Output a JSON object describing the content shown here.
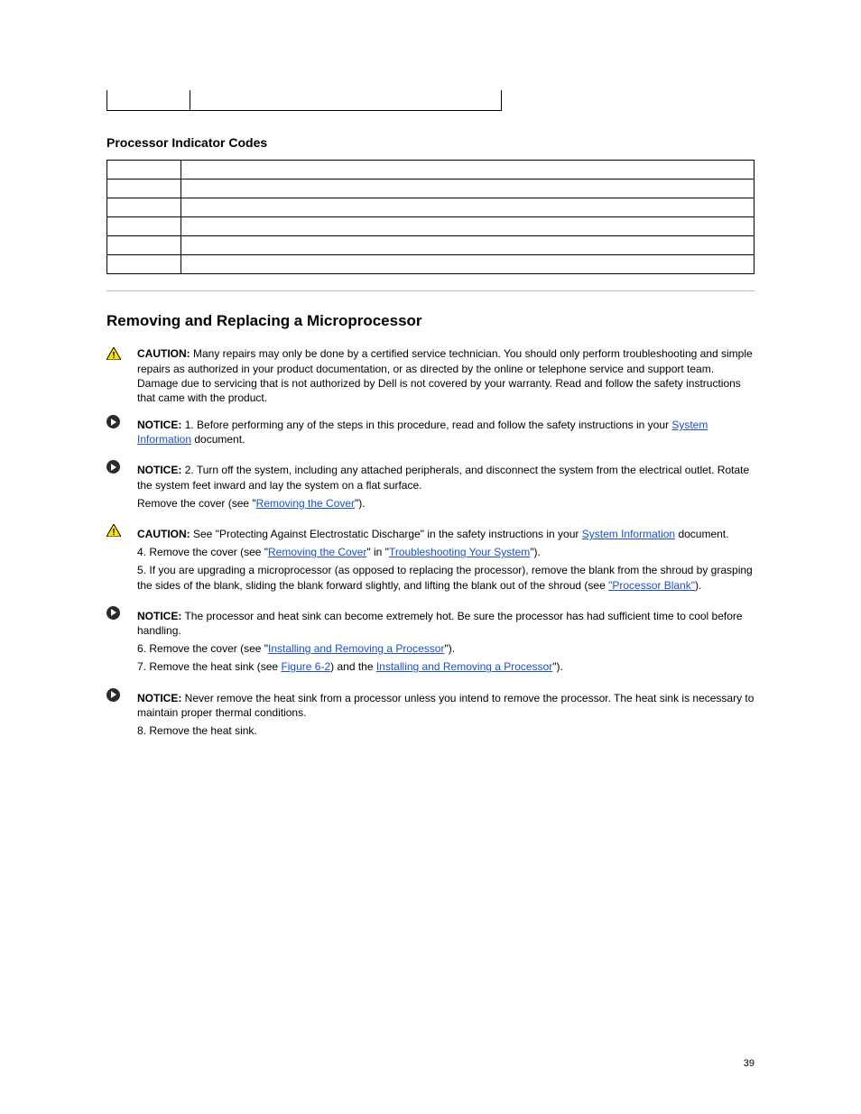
{
  "table1": {
    "row": {
      "c1": "",
      "c2": ""
    }
  },
  "section_title": "Processor Indicator Codes",
  "table2": {
    "rows": [
      {
        "code": "",
        "desc": ""
      },
      {
        "code": "",
        "desc": ""
      },
      {
        "code": "",
        "desc": ""
      },
      {
        "code": "",
        "desc": ""
      },
      {
        "code": "",
        "desc": ""
      },
      {
        "code": "",
        "desc": ""
      }
    ]
  },
  "main_title": "Removing and Replacing a Microprocessor",
  "caution1": {
    "lead": "CAUTION:",
    "text": " Many repairs may only be done by a certified service technician. You should only perform troubleshooting and simple repairs as authorized in your product documentation, or as directed by the online or telephone service and support team. Damage due to servicing that is not authorized by Dell is not covered by your warranty. Read and follow the safety instructions that came with the product."
  },
  "step1": {
    "lead": "NOTICE:",
    "num": "1.",
    "text": "Before performing any of the steps in this procedure, read and follow the safety instructions in your ",
    "link": "System Information",
    "after": " document."
  },
  "step2": {
    "lead": "NOTICE:",
    "num": "2.",
    "text_a": "Turn off the system, including any attached peripherals, and disconnect the system from the electrical outlet. Rotate the system feet inward and lay the system on a flat surface.",
    "text_b": "Remove the cover (see \"",
    "link_b": "Removing the Cover",
    "after_b": "\")."
  },
  "caution2": {
    "lead": "CAUTION:",
    "text_a": " See \"Protecting Against Electrostatic Discharge\" in the safety instructions in your ",
    "link_a": "System Information",
    "after_a": " document.",
    "num4": "4.",
    "text_b": "Remove the cover (see \"",
    "link_b1": "Removing the Cover",
    "mid_b": "\" in \"",
    "link_b2": "Troubleshooting Your System",
    "after_b": "\").",
    "num5": "5.",
    "text_c": "If you are upgrading a microprocessor (as opposed to replacing the processor), remove the blank from the shroud by grasping the sides of the blank, sliding the blank forward slightly, and lifting the blank out of the shroud (see ",
    "link_c": "\"Processor Blank\"",
    "after_c": ")."
  },
  "notice3": {
    "lead": "NOTICE:",
    "text_a": " The processor and heat sink can become extremely hot. Be sure the processor has had sufficient time to cool before handling.",
    "num6": "6.",
    "text_b": "Remove the cover (see \"",
    "link_b": "Installing and Removing a Processor",
    "after_b": "\").",
    "num7": "7.",
    "text_c": "Remove the heat sink (see ",
    "link_c1": "Figure 6-2",
    "after_c1": ") and the ",
    "link_c2": "Installing and Removing a Processor",
    "after_c2": "\")."
  },
  "notice4": {
    "lead": "NOTICE:",
    "text_a": " Never remove the heat sink from a processor unless you intend to remove the processor. The heat sink is necessary to maintain proper thermal conditions.",
    "num8": "8.",
    "text_b": "Remove the heat sink."
  },
  "footer": {
    "label": "",
    "page": "39"
  }
}
